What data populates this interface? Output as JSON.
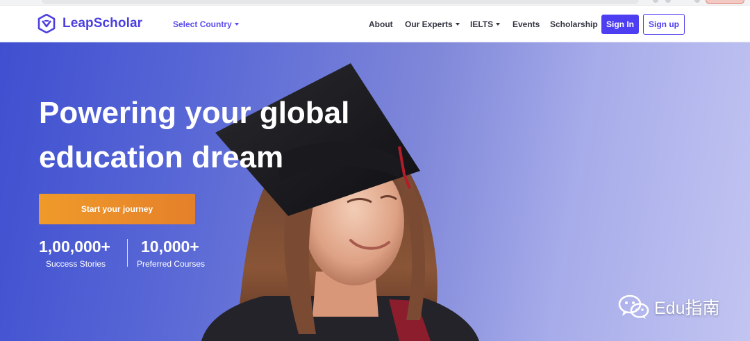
{
  "nav": {
    "logo_text": "LeapScholar",
    "country_select": "Select Country",
    "menu": [
      {
        "label": "About",
        "has_caret": false
      },
      {
        "label": "Our Experts",
        "has_caret": true
      },
      {
        "label": "IELTS",
        "has_caret": true
      },
      {
        "label": "Events",
        "has_caret": false
      },
      {
        "label": "Scholarship",
        "has_caret": false
      }
    ],
    "sign_in": "Sign In",
    "sign_up": "Sign up"
  },
  "hero": {
    "headline_line1": "Powering your global",
    "headline_line2": "education dream",
    "cta": "Start your journey",
    "stats": [
      {
        "number": "1,00,000+",
        "label": "Success Stories"
      },
      {
        "number": "10,000+",
        "label": "Preferred Courses"
      }
    ]
  },
  "watermark": {
    "text": "Edu指南",
    "icon": "wechat-icon"
  },
  "colors": {
    "brand": "#4d3ef2",
    "cta": "#e8872a",
    "hero_start": "#3f4fd0",
    "hero_end": "#c2c5f1"
  }
}
